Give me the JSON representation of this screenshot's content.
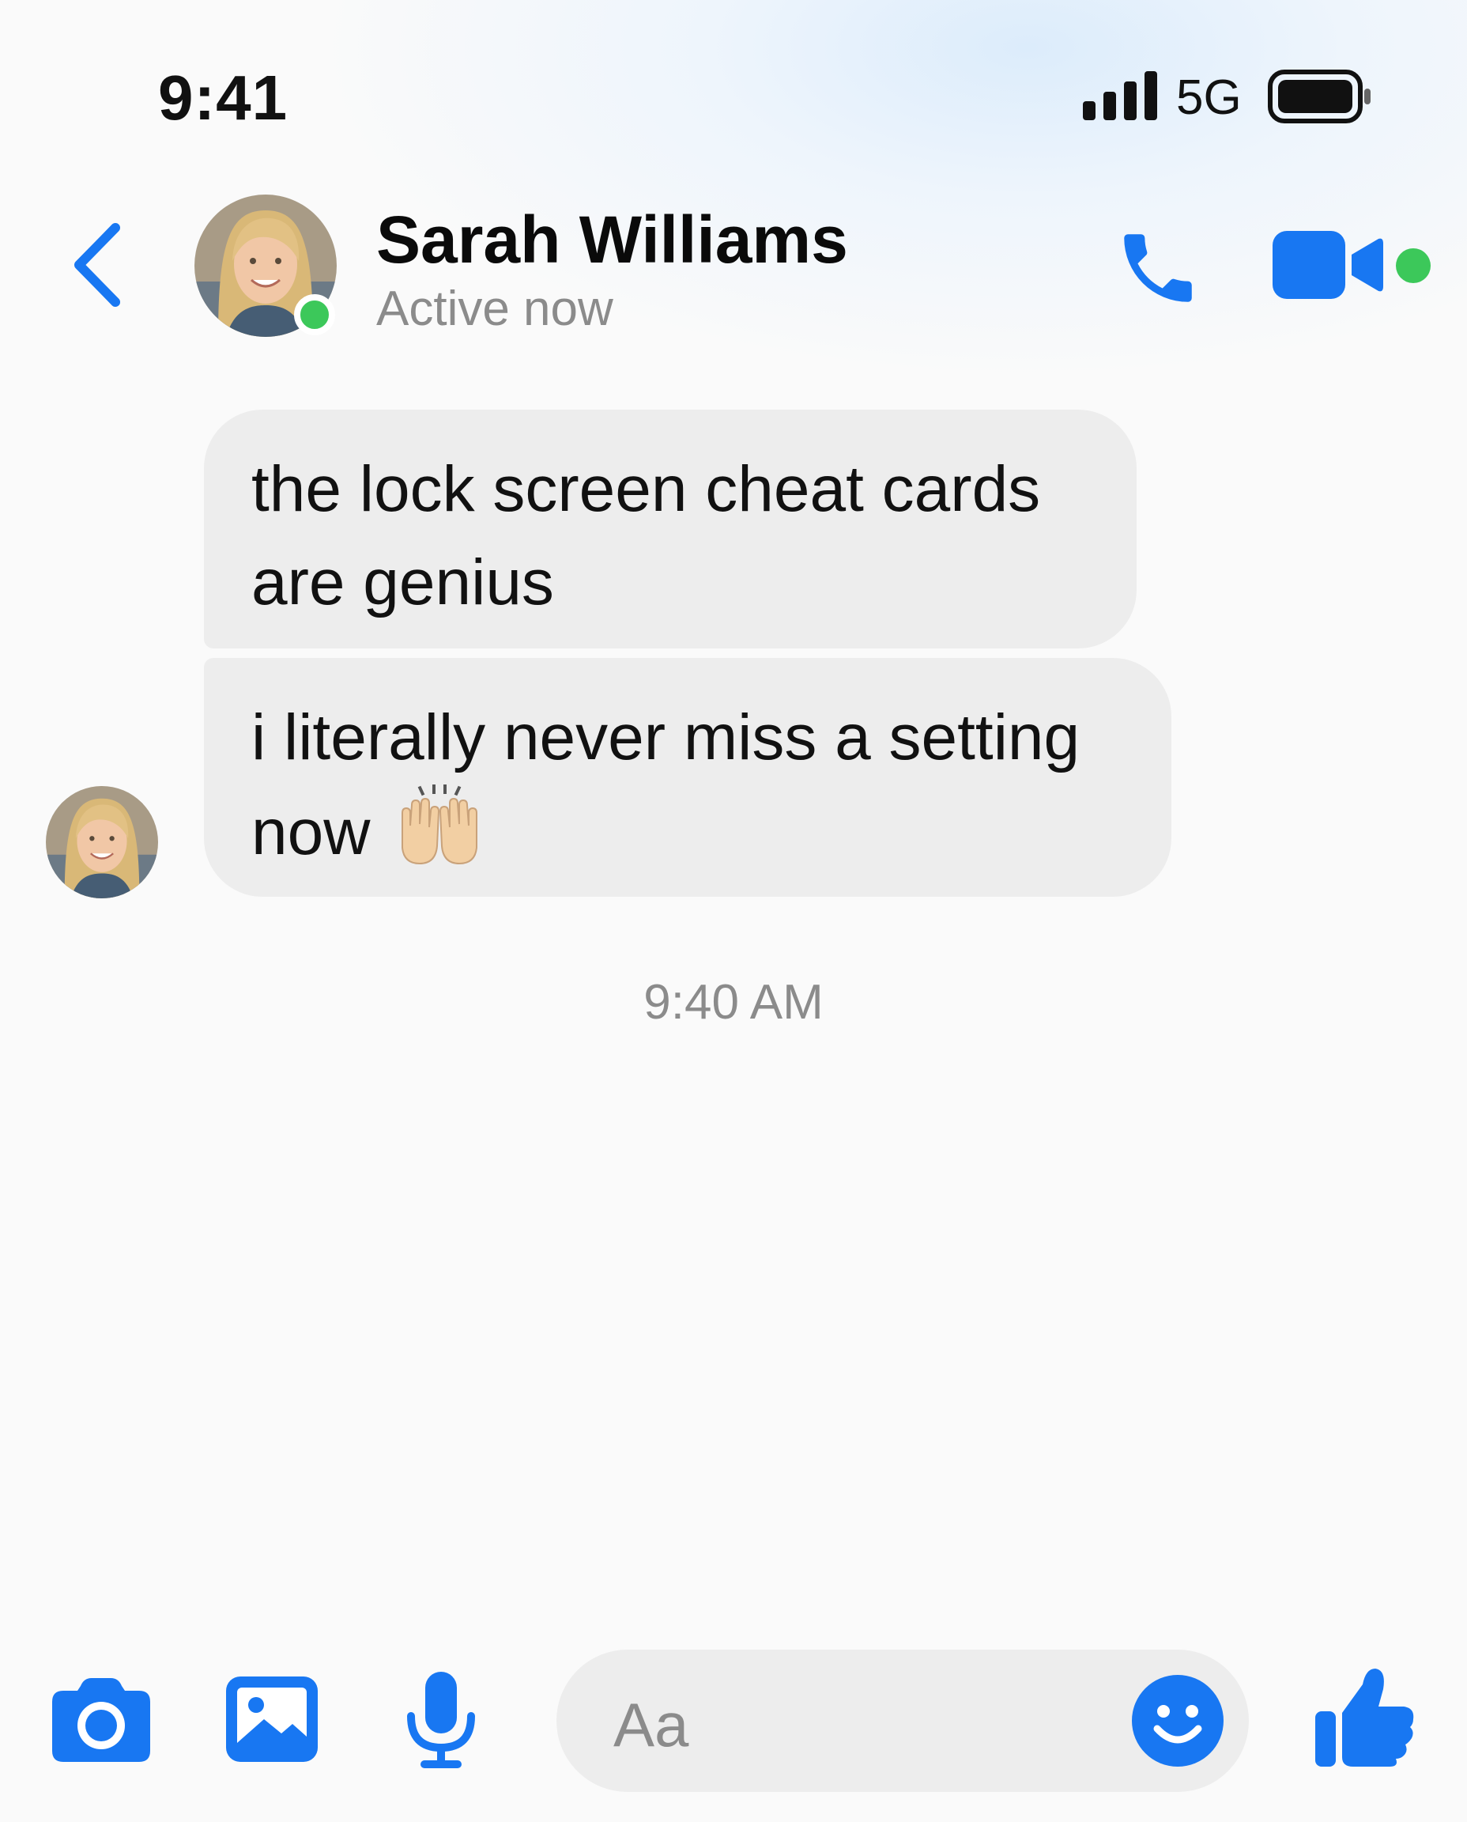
{
  "status_bar": {
    "time": "9:41",
    "network": "5G",
    "icons": [
      "signal-bars-icon",
      "battery-icon"
    ]
  },
  "header": {
    "contact_name": "Sarah Williams",
    "status": "Active now",
    "icons": [
      "back-chevron-icon",
      "phone-icon",
      "video-camera-icon"
    ],
    "accent_color": "#1877f2",
    "online_color": "#3cc85a"
  },
  "conversation": {
    "messages": [
      {
        "sender": "Sarah Williams",
        "lines": [
          "the lock screen cheat cards",
          "are genius"
        ]
      },
      {
        "sender": "Sarah Williams",
        "lines": [
          "i literally never miss a setting",
          "now"
        ],
        "emoji": "raising-hands-emoji"
      }
    ],
    "timestamp": "9:40 AM"
  },
  "composer": {
    "placeholder": "Aa",
    "icons": [
      "camera-icon",
      "gallery-icon",
      "microphone-icon",
      "emoji-smile-icon",
      "thumbs-up-icon"
    ]
  }
}
